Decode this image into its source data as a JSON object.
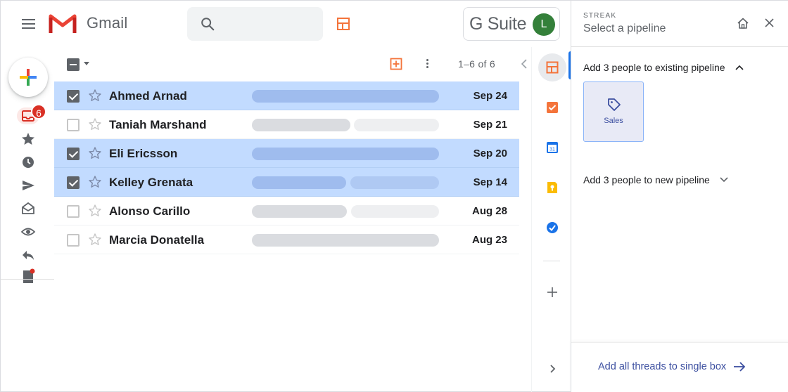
{
  "header": {
    "app_name": "Gmail",
    "search_placeholder": "",
    "gsuite_label": "G Suite",
    "avatar_initial": "L",
    "avatar_color": "#34803a"
  },
  "nav": {
    "inbox_badge": "6",
    "icons": [
      "compose-icon",
      "inbox-icon",
      "starred-icon",
      "snoozed-icon",
      "sent-icon",
      "drafts-icon",
      "watching-icon",
      "reply-icon",
      "notes-icon"
    ]
  },
  "toolbar": {
    "page_count": "1–6 of 6"
  },
  "emails": [
    {
      "sender": "Ahmed Arnad",
      "date": "Sep 24",
      "selected": true
    },
    {
      "sender": "Taniah Marshand",
      "date": "Sep 21",
      "selected": false
    },
    {
      "sender": "Eli Ericsson",
      "date": "Sep 20",
      "selected": true
    },
    {
      "sender": "Kelley Grenata",
      "date": "Sep 14",
      "selected": true
    },
    {
      "sender": "Alonso Carillo",
      "date": "Aug 28",
      "selected": false
    },
    {
      "sender": "Marcia Donatella",
      "date": "Aug 23",
      "selected": false
    }
  ],
  "side_panel_icons": [
    "streak-icon",
    "tasks-icon",
    "calendar-icon",
    "keep-icon",
    "check-icon",
    "add-icon",
    "expand-icon"
  ],
  "calendar_day": "31",
  "streak": {
    "brand": "STREAK",
    "title": "Select a pipeline",
    "existing_header": "Add 3 people to existing pipeline",
    "pipeline_name": "Sales",
    "new_header": "Add 3 people to new pipeline",
    "footer_link": "Add all threads to single box"
  },
  "colors": {
    "accent_blue": "#1a73e8",
    "selected_row": "#c2dbff",
    "streak_orange": "#f4743b",
    "badge_red": "#d93025",
    "link_indigo": "#3c4fa0"
  }
}
